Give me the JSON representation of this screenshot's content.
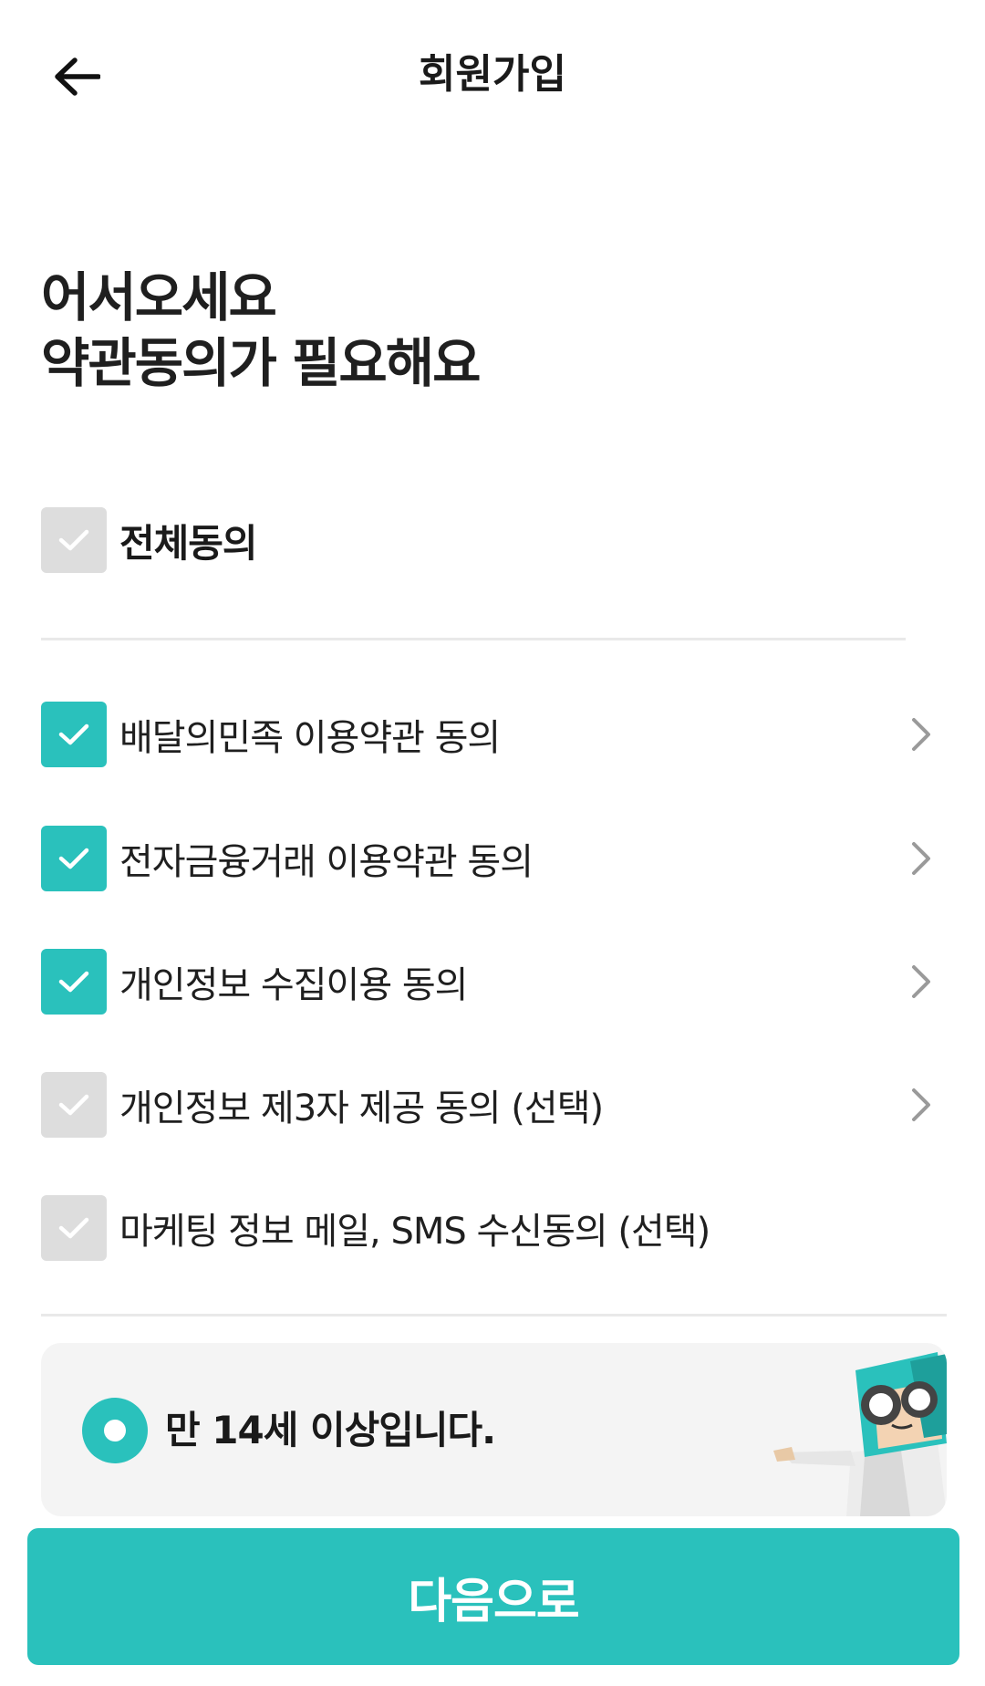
{
  "header": {
    "title": "회원가입",
    "back_icon": "arrow-left-icon"
  },
  "headline": {
    "line1": "어서오세요",
    "line2": "약관동의가 필요해요"
  },
  "all_agree": {
    "label": "전체동의",
    "checked": false
  },
  "terms": [
    {
      "label": "배달의민족 이용약관 동의",
      "checked": true,
      "has_detail": true
    },
    {
      "label": "전자금융거래 이용약관 동의",
      "checked": true,
      "has_detail": true
    },
    {
      "label": "개인정보 수집이용 동의",
      "checked": true,
      "has_detail": true
    },
    {
      "label": "개인정보 제3자 제공 동의 (선택)",
      "checked": false,
      "has_detail": true
    },
    {
      "label": "마케팅 정보 메일, SMS 수신동의 (선택)",
      "checked": false,
      "has_detail": false
    }
  ],
  "age_confirm": {
    "label": "만 14세 이상입니다.",
    "selected": true
  },
  "next_button": {
    "label": "다음으로"
  },
  "colors": {
    "accent": "#2ac1bc",
    "unchecked": "#dddddd",
    "panel": "#f4f4f4"
  }
}
